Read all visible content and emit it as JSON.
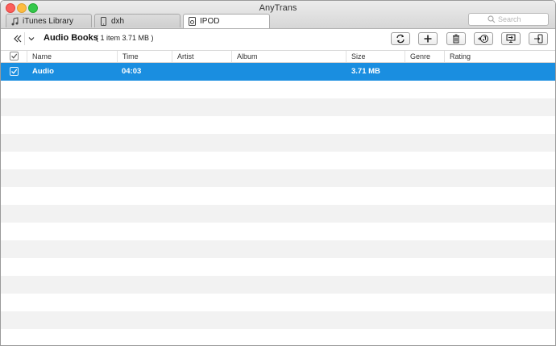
{
  "window": {
    "title": "AnyTrans"
  },
  "tabs": [
    {
      "label": "iTunes Library",
      "icon": "music-note-icon"
    },
    {
      "label": "dxh",
      "icon": "iphone-icon"
    },
    {
      "label": "IPOD",
      "icon": "ipod-icon",
      "active": true
    }
  ],
  "search": {
    "placeholder": "Search"
  },
  "toolbar": {
    "category": "Audio Books",
    "info": "( 1 item  3.71 MB )",
    "buttons": [
      "refresh-icon",
      "add-icon",
      "delete-icon",
      "to-itunes-icon",
      "to-computer-icon",
      "to-device-icon"
    ]
  },
  "table": {
    "columns": [
      "Name",
      "Time",
      "Artist",
      "Album",
      "Size",
      "Genre",
      "Rating"
    ],
    "rows": [
      {
        "checked": true,
        "name": "Audio",
        "time": "04:03",
        "artist": "",
        "album": "",
        "size": "3.71 MB",
        "genre": "",
        "rating": ""
      }
    ]
  },
  "colors": {
    "selection": "#1a8ee0",
    "stripe": "#f2f2f2"
  }
}
